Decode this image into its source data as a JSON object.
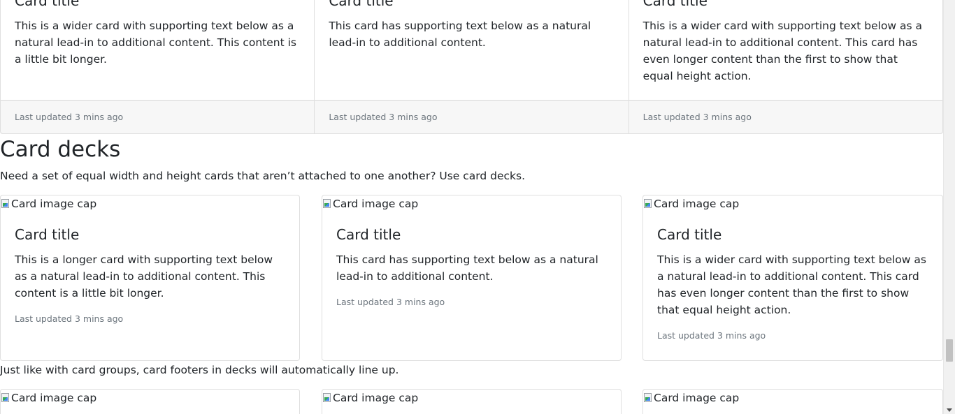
{
  "card_group": {
    "cards": [
      {
        "title": "Card title",
        "text": "This is a wider card with supporting text below as a natural lead-in to additional content. This content is a little bit longer.",
        "footer": "Last updated 3 mins ago"
      },
      {
        "title": "Card title",
        "text": "This card has supporting text below as a natural lead-in to additional content.",
        "footer": "Last updated 3 mins ago"
      },
      {
        "title": "Card title",
        "text": "This is a wider card with supporting text below as a natural lead-in to additional content. This card has even longer content than the first to show that equal height action.",
        "footer": "Last updated 3 mins ago"
      }
    ]
  },
  "section": {
    "heading": "Card decks",
    "lead": "Need a set of equal width and height cards that aren’t attached to one another? Use card decks."
  },
  "deck": {
    "cards": [
      {
        "img_alt": "Card image cap",
        "title": "Card title",
        "text": "This is a longer card with supporting text below as a natural lead-in to additional content. This content is a little bit longer.",
        "muted": "Last updated 3 mins ago"
      },
      {
        "img_alt": "Card image cap",
        "title": "Card title",
        "text": "This card has supporting text below as a natural lead-in to additional content.",
        "muted": "Last updated 3 mins ago"
      },
      {
        "img_alt": "Card image cap",
        "title": "Card title",
        "text": "This is a wider card with supporting text below as a natural lead-in to additional content. This card has even longer content than the first to show that equal height action.",
        "muted": "Last updated 3 mins ago"
      }
    ]
  },
  "deck_note": "Just like with card groups, card footers in decks will automatically line up.",
  "deck2": {
    "cards": [
      {
        "img_alt": "Card image cap"
      },
      {
        "img_alt": "Card image cap"
      },
      {
        "img_alt": "Card image cap"
      }
    ]
  },
  "colors": {
    "text": "#212529",
    "muted": "#6c757d",
    "border": "rgba(0,0,0,0.125)",
    "footer_bg": "rgba(0,0,0,0.03)"
  }
}
